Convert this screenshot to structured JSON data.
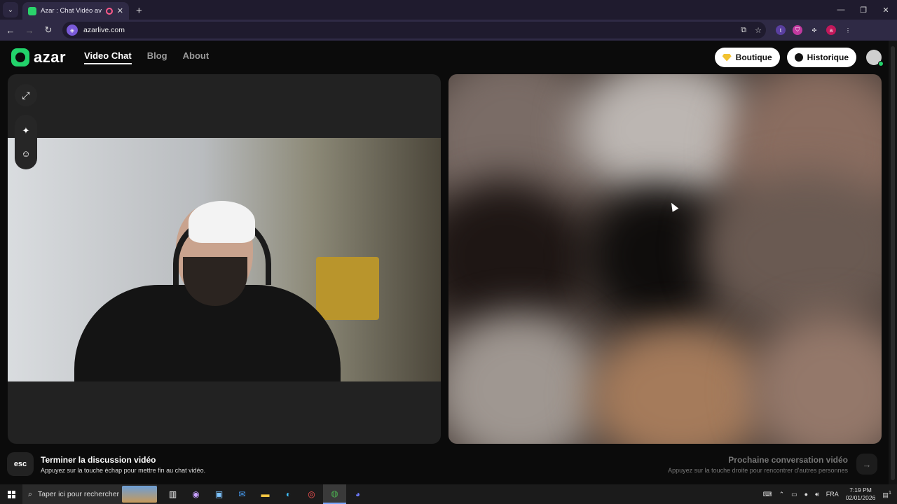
{
  "browser": {
    "tab_title": "Azar : Chat Vidéo avec de",
    "url": "azarlive.com",
    "tab_list_icon": "chevron-down-icon",
    "new_tab_label": "+",
    "window_controls": [
      "—",
      "❐",
      "✕"
    ]
  },
  "site": {
    "logo_text": "azar",
    "nav": [
      {
        "label": "Video Chat",
        "active": true
      },
      {
        "label": "Blog",
        "active": false
      },
      {
        "label": "About",
        "active": false
      }
    ],
    "boutique_label": "Boutique",
    "historique_label": "Historique"
  },
  "left_panel": {
    "tools": [
      "expand-icon",
      "sparkle-icon",
      "smiley-icon"
    ]
  },
  "footer": {
    "esc_label": "esc",
    "end_title": "Terminer la discussion vidéo",
    "end_desc": "Appuyez sur la touche échap pour mettre fin au chat vidéo.",
    "next_title": "Prochaine conversation vidéo",
    "next_desc": "Appuyez sur la touche droite pour rencontrer d'autres personnes",
    "next_icon": "→"
  },
  "taskbar": {
    "search_placeholder": "Taper ici pour rechercher",
    "language": "FRA",
    "time": "7:19 PM",
    "date": "02/01/2026",
    "notification_count": "1"
  },
  "colors": {
    "brand": "#22d36b",
    "browser_frame": "#1f1b2e",
    "browser_toolbar": "#2f2a45",
    "page_bg": "#0b0b0b",
    "panel_bg": "#222222"
  }
}
